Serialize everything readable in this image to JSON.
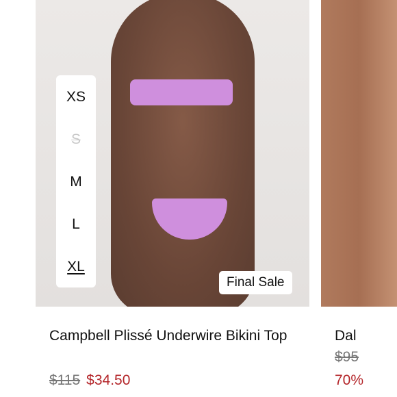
{
  "product_main": {
    "sizes": [
      {
        "label": "XS",
        "state": "available"
      },
      {
        "label": "S",
        "state": "unavailable"
      },
      {
        "label": "M",
        "state": "available"
      },
      {
        "label": "L",
        "state": "available"
      },
      {
        "label": "XL",
        "state": "selected"
      }
    ],
    "badge": "Final Sale",
    "title": "Campbell Plissé Underwire Bikini Top",
    "original_price": "$115",
    "sale_price": "$34.50"
  },
  "product_next": {
    "title": "Dal",
    "original_price": "$95",
    "discount": "70%"
  },
  "colors": {
    "sale": "#b4262a",
    "strikethrough": "#777777",
    "garment": "#cf8fdd"
  }
}
